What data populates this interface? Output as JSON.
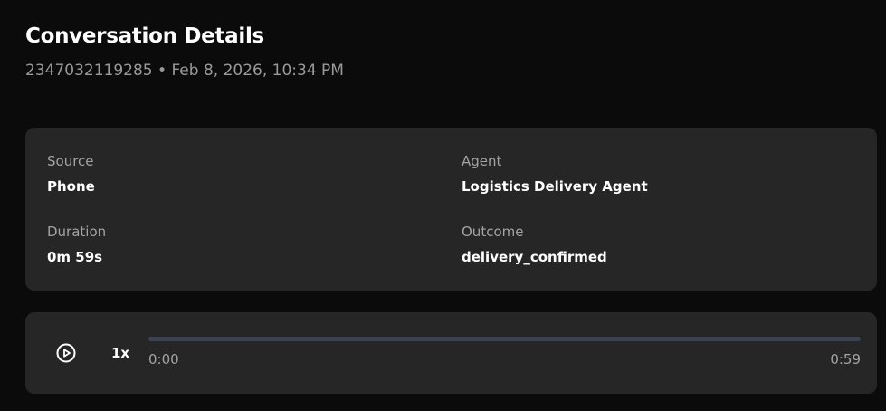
{
  "header": {
    "title": "Conversation Details",
    "subtitle": "2347032119285 • Feb 8, 2026, 10:34 PM"
  },
  "details": {
    "source": {
      "label": "Source",
      "value": "Phone"
    },
    "agent": {
      "label": "Agent",
      "value": "Logistics Delivery Agent"
    },
    "duration": {
      "label": "Duration",
      "value": "0m 59s"
    },
    "outcome": {
      "label": "Outcome",
      "value": "delivery_confirmed"
    }
  },
  "player": {
    "play_icon": "play-circle-icon",
    "speed": "1x",
    "current_time": "0:00",
    "total_time": "0:59",
    "progress": 0,
    "track_color": "#3c4250"
  }
}
